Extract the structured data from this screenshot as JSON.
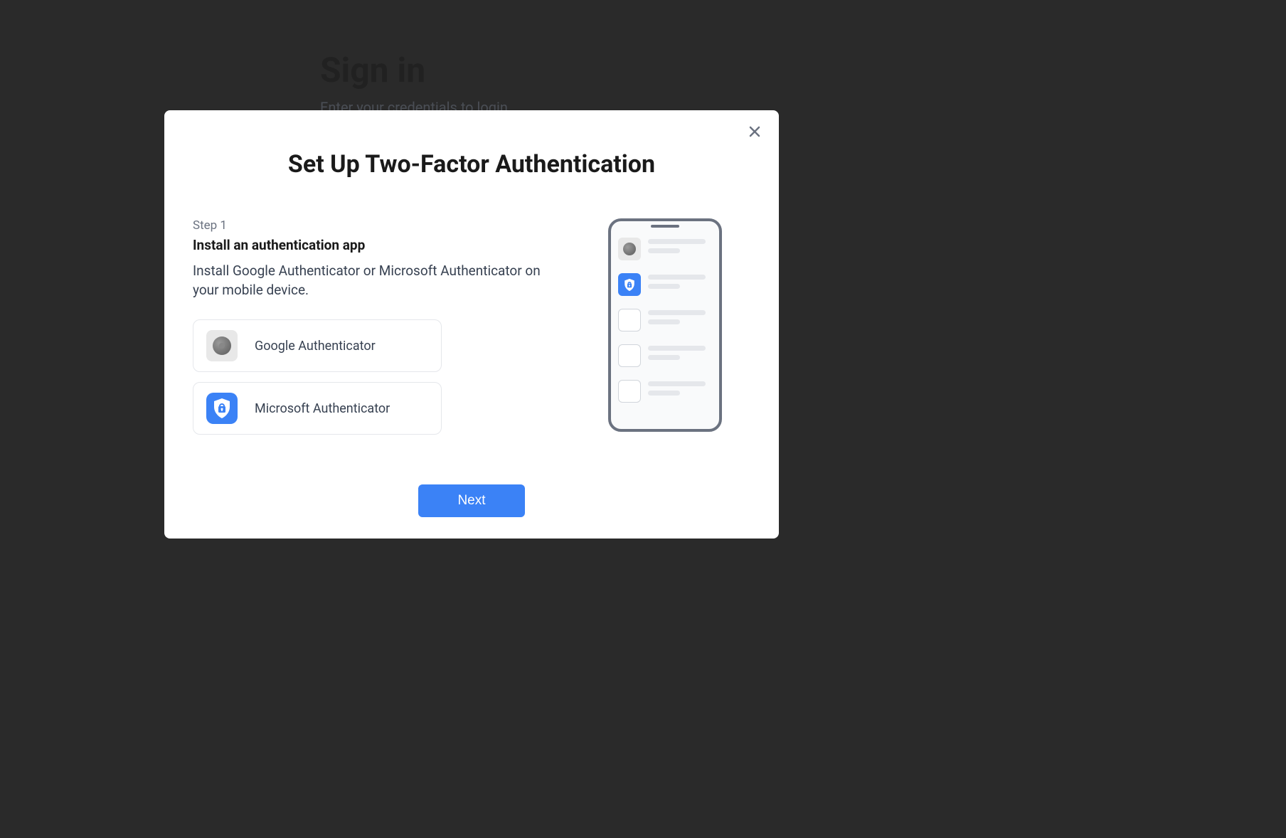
{
  "background": {
    "signin_title": "Sign in",
    "signin_subtitle": "Enter your credentials to login"
  },
  "modal": {
    "title": "Set Up Two-Factor Authentication",
    "step_label": "Step 1",
    "step_title": "Install an authentication app",
    "step_description": "Install Google Authenticator or Microsoft Authenticator on your mobile device.",
    "apps": [
      {
        "label": "Google Authenticator"
      },
      {
        "label": "Microsoft Authenticator"
      }
    ],
    "next_button": "Next"
  }
}
